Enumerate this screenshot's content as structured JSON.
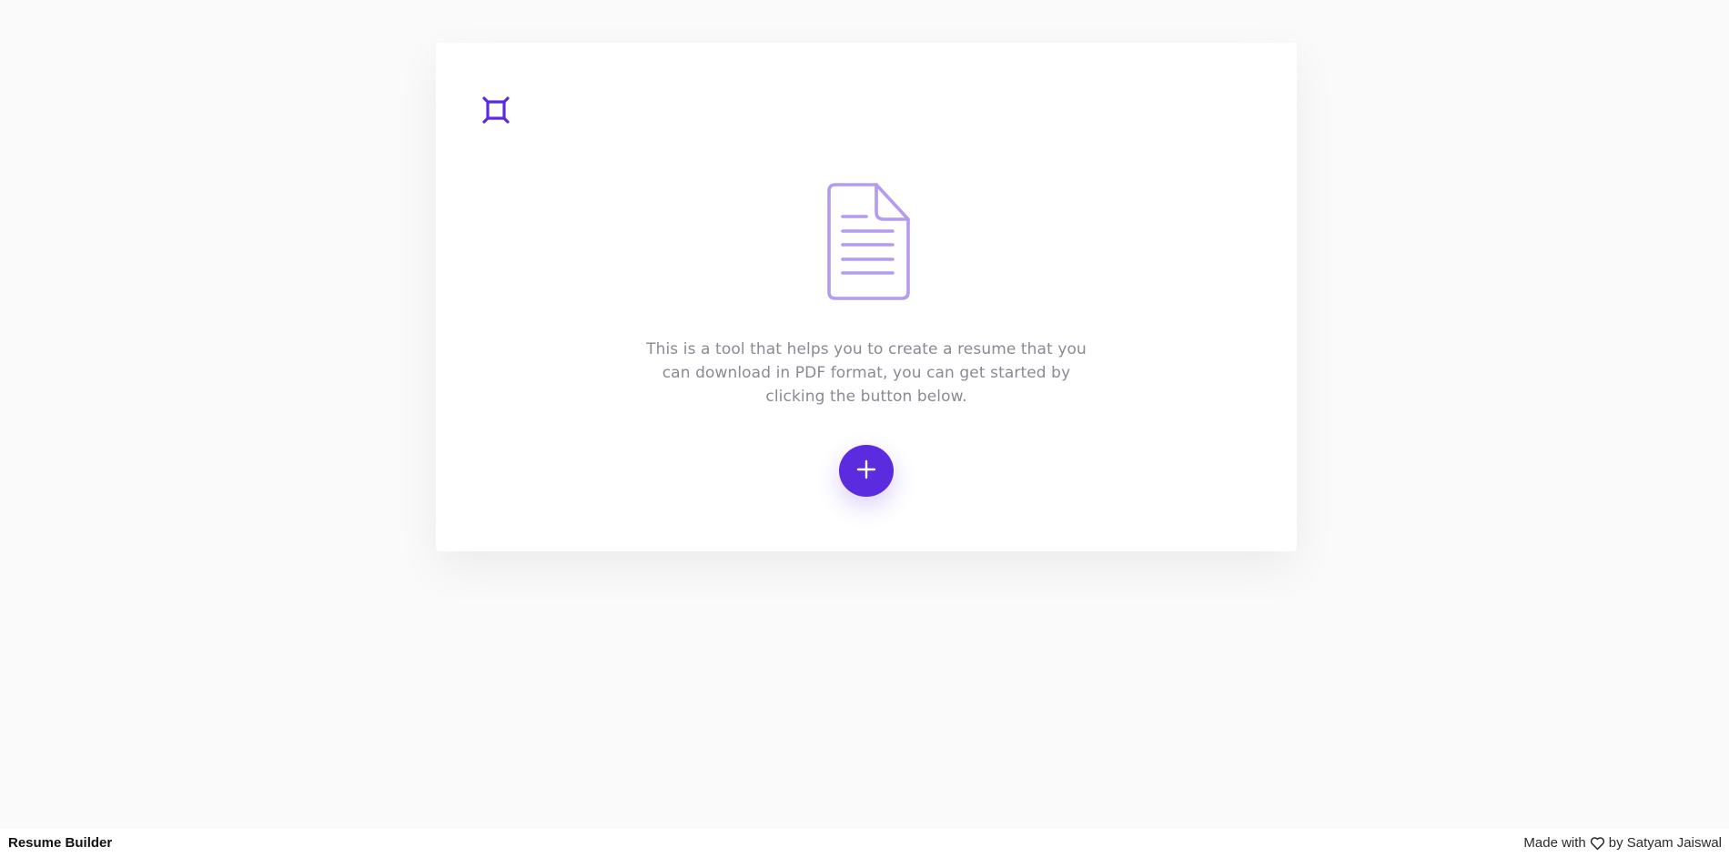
{
  "main": {
    "description": "This is a tool that helps you to create a resume that you can download in PDF format, you can get started by clicking the button below.",
    "add_button_icon": "plus-icon",
    "logo_icon": "frame-logo-icon",
    "illustration_icon": "document-icon"
  },
  "footer": {
    "brand": "Resume Builder",
    "made_with": "Made with",
    "heart_icon": "heart-icon",
    "by_author": "by Satyam Jaiswal"
  },
  "colors": {
    "accent": "#5b2be0",
    "illustration": "#b49af0",
    "text_muted": "#8a8a95",
    "background": "#fafafa"
  }
}
